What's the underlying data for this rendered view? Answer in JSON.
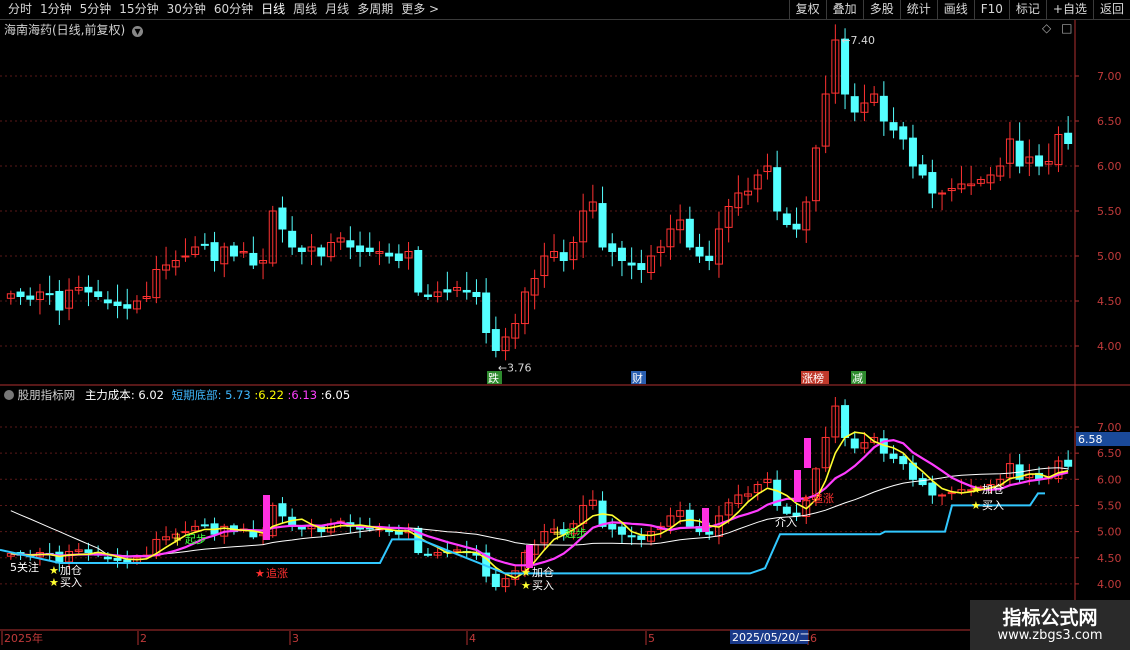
{
  "toolbar": {
    "periods": [
      "分时",
      "1分钟",
      "5分钟",
      "15分钟",
      "30分钟",
      "60分钟",
      "日线",
      "周线",
      "月线",
      "多周期",
      "更多"
    ],
    "active_period": "日线",
    "more_arrow": ">",
    "actions": [
      "复权",
      "叠加",
      "多股",
      "统计",
      "画线",
      "F10",
      "标记",
      "+自选",
      "返回"
    ]
  },
  "main_chart": {
    "title": "海南海药(日线,前复权)",
    "price_labels": [
      "7.00",
      "6.50",
      "6.00",
      "5.50",
      "5.00",
      "4.50",
      "4.00"
    ],
    "high_marker": "7.40",
    "low_marker": "3.76",
    "event_tags": [
      {
        "text": "跌",
        "color": "#2e8b2e"
      },
      {
        "text": "财",
        "color": "#2a5fb0"
      },
      {
        "text": "涨榜",
        "color": "#c0392b"
      },
      {
        "text": "减",
        "color": "#2e8b2e"
      }
    ]
  },
  "indicator": {
    "name": "股朋指标网",
    "cost_label": "主力成本",
    "cost_value": "6.02",
    "bottom_label": "短期底部",
    "bottom_value": "5.73",
    "v1": "6.22",
    "v2": "6.13",
    "v3": "6.05",
    "current_value": "6.58",
    "price_labels": [
      "7.00",
      "6.50",
      "6.00",
      "5.50",
      "5.00",
      "4.50",
      "4.00"
    ],
    "signals": [
      "5关注",
      "加仓",
      "买入",
      "起步",
      "追涨",
      "加仓",
      "买入",
      "起步",
      "介入",
      "追涨",
      "加仓",
      "买入"
    ]
  },
  "time_axis": {
    "labels": [
      "2025年",
      "2",
      "3",
      "4",
      "5",
      "6"
    ],
    "cursor_date": "2025/05/20/二"
  },
  "watermark": {
    "line1": "指标公式网",
    "line2": "www.zbgs3.com"
  },
  "chart_data": {
    "type": "candlestick",
    "title": "海南海药(日线,前复权)",
    "ylim": [
      3.6,
      7.6
    ],
    "yticks": [
      4.0,
      4.5,
      5.0,
      5.5,
      6.0,
      6.5,
      7.0
    ],
    "high": 7.4,
    "low": 3.76,
    "close_series": [
      4.58,
      4.55,
      4.52,
      4.6,
      4.58,
      4.4,
      4.62,
      4.65,
      4.6,
      4.55,
      4.48,
      4.45,
      4.42,
      4.5,
      4.55,
      4.85,
      4.9,
      4.95,
      5.0,
      5.1,
      5.12,
      4.95,
      5.1,
      5.0,
      5.05,
      4.9,
      4.95,
      5.5,
      5.3,
      5.1,
      5.05,
      5.1,
      5.0,
      5.15,
      5.2,
      5.1,
      5.05,
      5.05,
      5.05,
      5.0,
      4.95,
      5.05,
      4.6,
      4.55,
      4.6,
      4.6,
      4.65,
      4.6,
      4.55,
      4.15,
      3.95,
      4.1,
      4.25,
      4.6,
      4.75,
      5.0,
      5.05,
      4.95,
      5.15,
      5.5,
      5.6,
      5.1,
      5.05,
      4.95,
      4.9,
      4.85,
      5.0,
      5.1,
      5.3,
      5.4,
      5.1,
      5.0,
      4.95,
      5.3,
      5.55,
      5.7,
      5.72,
      5.9,
      6.0,
      5.5,
      5.35,
      5.3,
      5.6,
      6.2,
      6.8,
      7.4,
      6.8,
      6.6,
      6.7,
      6.8,
      6.5,
      6.4,
      6.3,
      6.0,
      5.9,
      5.7,
      5.7,
      5.75,
      5.8,
      5.8,
      5.85,
      5.9,
      6.0,
      6.3,
      6.0,
      6.1,
      6.0,
      6.05,
      6.35,
      6.25
    ]
  }
}
